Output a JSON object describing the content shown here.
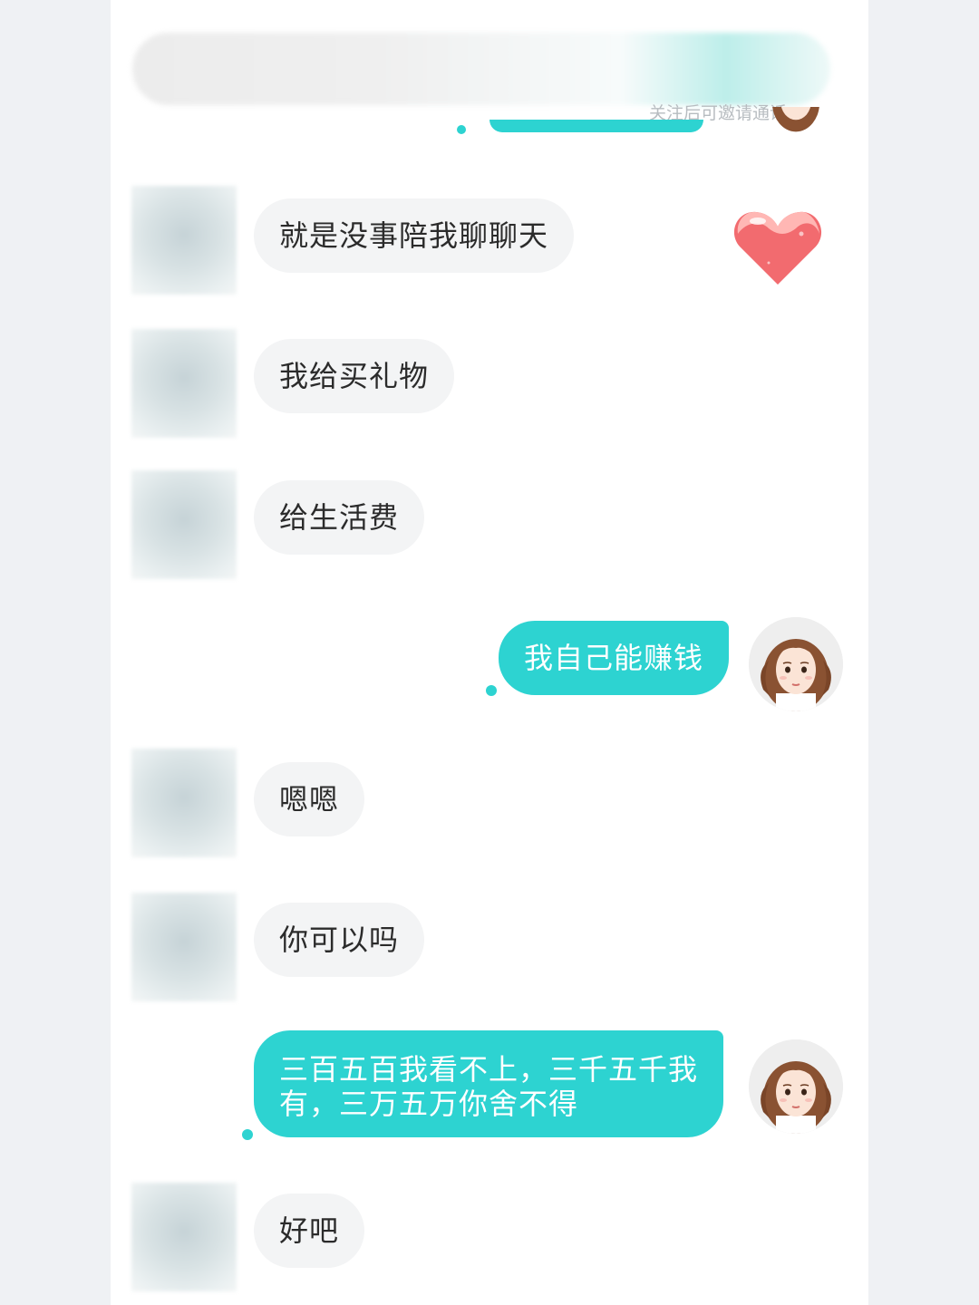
{
  "header": {
    "hint_text": "关注后可邀请通话"
  },
  "messages": [
    {
      "side": "in",
      "text": "就是没事陪我聊聊天"
    },
    {
      "side": "in",
      "text": "我给买礼物"
    },
    {
      "side": "in",
      "text": "给生活费"
    },
    {
      "side": "out",
      "text": "我自己能赚钱"
    },
    {
      "side": "in",
      "text": "嗯嗯"
    },
    {
      "side": "in",
      "text": "你可以吗"
    },
    {
      "side": "out",
      "text": "三百五百我看不上，三千五千我有，三万五万你舍不得"
    },
    {
      "side": "in",
      "text": "好吧"
    }
  ],
  "sticker": {
    "icon": "heart-icon",
    "color": "#f26b6f"
  },
  "colors": {
    "accent": "#2dd3d1",
    "incoming_bubble": "#f3f4f5",
    "page_background": "#eff1f4"
  }
}
